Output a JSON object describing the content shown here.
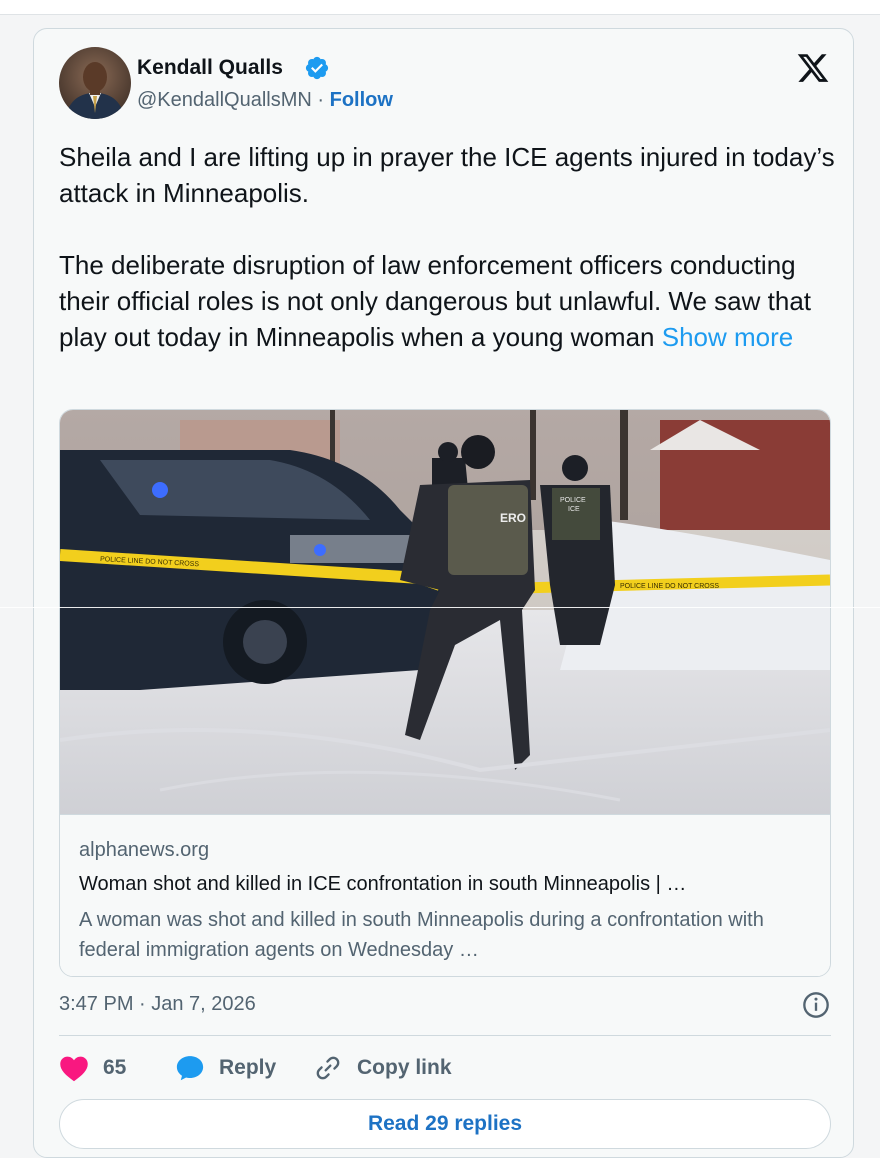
{
  "author": {
    "name": "Kendall Qualls",
    "handle": "@KendallQuallsMN",
    "separator": "·",
    "follow_label": "Follow"
  },
  "tweet": {
    "paragraph_1": "Sheila and I are lifting up in prayer the ICE agents injured in today’s attack in Minneapolis.",
    "paragraph_2": "The deliberate disruption of law enforcement officers conducting their official roles is not only dangerous but unlawful. We saw that play out today in Minneapolis when a young woman",
    "show_more_label": "Show more"
  },
  "link_card": {
    "domain": "alphanews.org",
    "headline": "Woman shot and killed in ICE confrontation in south Minneapolis | …",
    "description": "A woman was shot and killed in south Minneapolis during a confrontation with federal immigration agents on Wednesday …",
    "photo_text": {
      "vest_label": "ERO",
      "police_label": "POLICE",
      "ice_label": "ICE",
      "tape_text": "POLICE LINE DO NOT CROSS"
    }
  },
  "meta": {
    "timestamp": "3:47 PM · Jan 7, 2026"
  },
  "actions": {
    "like_count": "65",
    "reply_label": "Reply",
    "copy_link_label": "Copy link"
  },
  "footer": {
    "read_replies_label": "Read 29 replies"
  },
  "colors": {
    "accent": "#1d9bf0",
    "follow": "#1d72c4",
    "like": "#f91880",
    "muted": "#536471"
  },
  "icons": [
    "verified-badge-icon",
    "x-logo-icon",
    "info-icon",
    "heart-icon",
    "reply-bubble-icon",
    "link-icon"
  ]
}
